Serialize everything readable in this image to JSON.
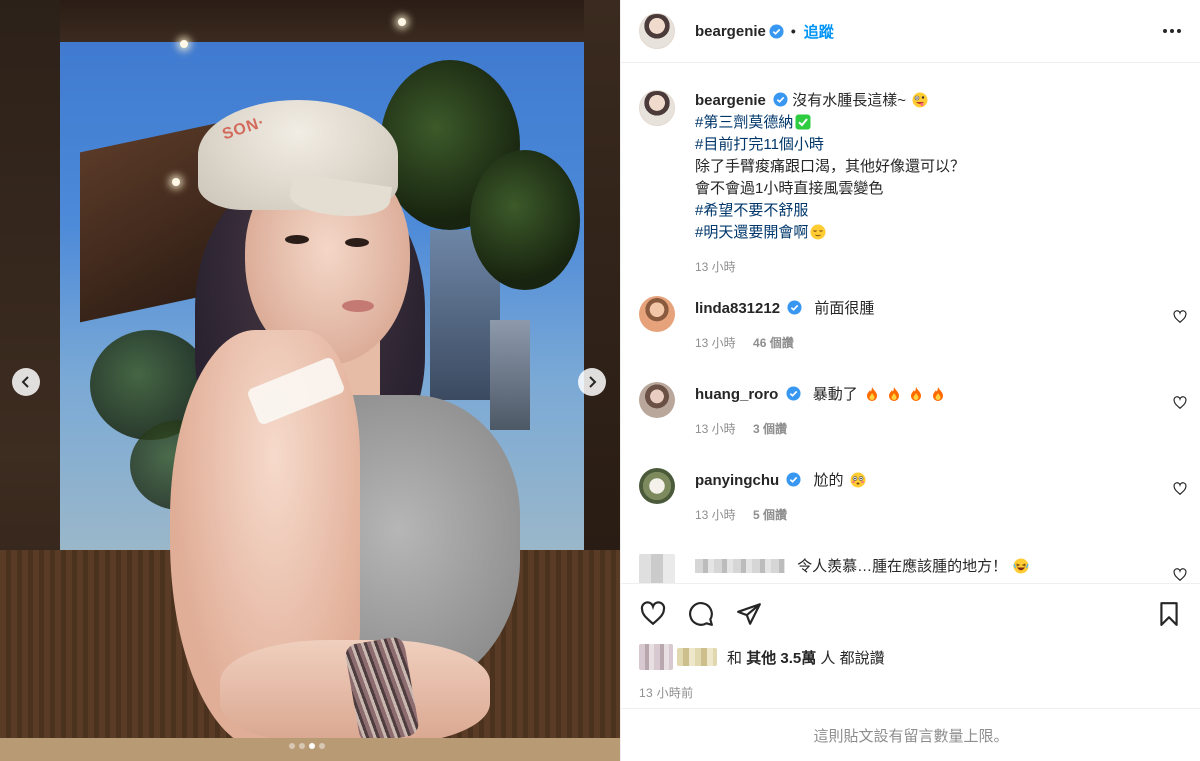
{
  "post": {
    "username": "beargenie",
    "follow_label": "追蹤",
    "separator": "•",
    "caption": {
      "line1": "沒有水腫長這樣~",
      "hashtags": {
        "tag1": "#第三劑莫德納",
        "tag2": "#目前打完11個小時",
        "tag3": "#希望不要不舒服",
        "tag4": "#明天還要開會啊"
      },
      "text1": "除了手臂痠痛跟口渴，其他好像還可以？",
      "text2": "會不會過1小時直接風雲變色",
      "time": "13 小時"
    }
  },
  "media": {
    "cap_text": "SON·",
    "carousel": {
      "total": 4,
      "active_index": 2
    }
  },
  "comments": [
    {
      "username": "linda831212",
      "text": "前面很腫",
      "time": "13 小時",
      "likes": "46 個讚"
    },
    {
      "username": "huang_roro",
      "text": "暴動了",
      "emoji": "fire-emoji x4",
      "time": "13 小時",
      "likes": "3 個讚"
    },
    {
      "username": "panyingchu",
      "text": "尬的",
      "emoji": "flushed-face-emoji",
      "time": "13 小時",
      "likes": "5 個讚"
    },
    {
      "username": "",
      "text": "令人羨慕…腫在應該腫的地方！",
      "emoji": "laughing-emoji"
    }
  ],
  "likes": {
    "prefix": "和",
    "other_label": "其他",
    "count": "3.5萬",
    "suffix": "人 都說讚"
  },
  "timestamp": "13 小時前",
  "comments_limited": "這則貼文設有留言數量上限。",
  "colors": {
    "link": "#0095f6",
    "hashtag": "#00376b",
    "verified": "#3897f0",
    "muted": "#8e8e8e"
  }
}
